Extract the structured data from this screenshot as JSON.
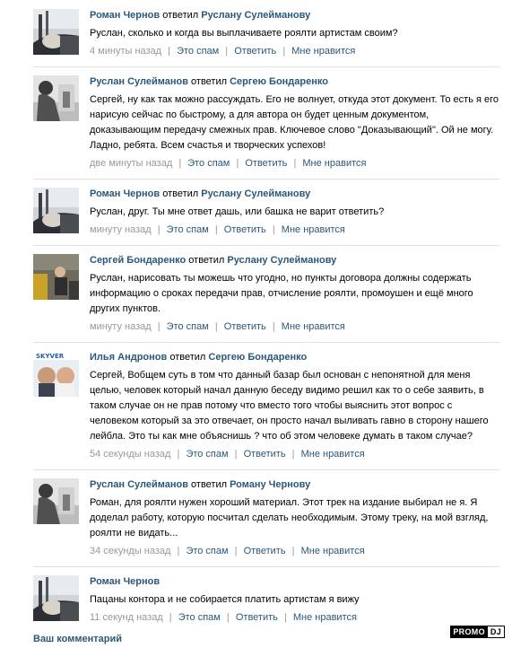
{
  "comments": [
    {
      "avatar": "avatar-roman",
      "author": "Роман Чернов",
      "verb": "ответил",
      "target": "Руслану Сулейманову",
      "text": "Руслан, сколько и когда вы выплачиваете роялти артистам своим?",
      "time": "4 минуты назад",
      "spam": "Это спам",
      "reply": "Ответить",
      "like": "Мне нравится"
    },
    {
      "avatar": "avatar-ruslan",
      "author": "Руслан Сулейманов",
      "verb": "ответил",
      "target": "Сергею Бондаренко",
      "text": "Сергей, ну как так можно рассуждать. Его не волнует, откуда этот документ. То есть я его нарисую сейчас по быстрому, а для автора он будет ценным документом, доказывающим передачу смежных прав. Ключевое слово \"Доказывающий\". Ой не могу. Ладно, ребята. Всем счастья и творческих успехов!",
      "time": "две минуты назад",
      "spam": "Это спам",
      "reply": "Ответить",
      "like": "Мне нравится"
    },
    {
      "avatar": "avatar-roman",
      "author": "Роман Чернов",
      "verb": "ответил",
      "target": "Руслану Сулейманову",
      "text": "Руслан, друг. Ты мне ответ дашь, или башка не варит ответить?",
      "time": "минуту назад",
      "spam": "Это спам",
      "reply": "Ответить",
      "like": "Мне нравится"
    },
    {
      "avatar": "avatar-sergey",
      "author": "Сергей Бондаренко",
      "verb": "ответил",
      "target": "Руслану Сулейманову",
      "text": "Руслан, нарисовать ты можешь что угодно, но пункты договора должны содержать информацию о сроках передачи прав, отчисление роялти, промоушен и ещё много других пунктов.",
      "time": "минуту назад",
      "spam": "Это спам",
      "reply": "Ответить",
      "like": "Мне нравится"
    },
    {
      "avatar": "avatar-ilya",
      "author": "Илья Андронов",
      "verb": "ответил",
      "target": "Сергею Бондаренко",
      "text": "Сергей, Вобщем суть в том что данный базар был основан с непонятной для меня целью, человек который начал данную беседу видимо решил как то о себе заявить, в таком случае он не прав потому что вместо того чтобы выяснить этот вопрос с человеком который за это отвечает, он просто начал выливать гавно в сторону нашего лейбла. Это ты как мне объяснишь ? что об этом человеке думать в таком случае?",
      "time": "54 секунды назад",
      "spam": "Это спам",
      "reply": "Ответить",
      "like": "Мне нравится"
    },
    {
      "avatar": "avatar-ruslan",
      "author": "Руслан Сулейманов",
      "verb": "ответил",
      "target": "Роману Чернову",
      "text": "Роман, для роялти нужен хороший материал. Этот трек на издание выбирал не я. Я доделал работу, которую посчитал сделать необходимым. Этому треку, на мой взгляд, роялти не видать...",
      "time": "34 секунды назад",
      "spam": "Это спам",
      "reply": "Ответить",
      "like": "Мне нравится"
    },
    {
      "avatar": "avatar-roman",
      "author": "Роман Чернов",
      "verb": "",
      "target": "",
      "text": "Пацаны контора и не собирается платить артистам я вижу",
      "time": "11 секунд назад",
      "spam": "Это спам",
      "reply": "Ответить",
      "like": "Мне нравится"
    }
  ],
  "footer": {
    "your_comment": "Ваш комментарий"
  },
  "watermark": {
    "part1": "PROMO",
    "part2": "DJ"
  },
  "colors": {
    "link": "#2b587a",
    "meta": "#999999",
    "divider": "#dae1e8"
  }
}
